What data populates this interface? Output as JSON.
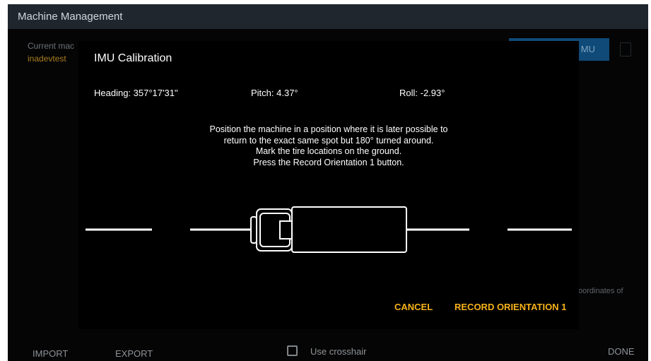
{
  "app": {
    "title": "Machine Management",
    "current_machine_label": "Current mac",
    "current_machine_value": "inadevtest",
    "imu_button_label": "MU",
    "coords_text": "oordinates of",
    "import_label": "IMPORT",
    "export_label": "EXPORT",
    "crosshair_label": "Use crosshair",
    "done_label": "DONE"
  },
  "dialog": {
    "title": "IMU Calibration",
    "heading": "Heading: 357°17'31\"",
    "pitch": "Pitch: 4.37°",
    "roll": "Roll: -2.93°",
    "instructions": [
      "Position the machine in a position where it is later possible to",
      "return to the exact same spot but 180° turned around.",
      "Mark the tire locations on the ground.",
      "Press the Record Orientation 1 button."
    ],
    "cancel_label": "CANCEL",
    "record_label": "RECORD ORIENTATION 1"
  },
  "colors": {
    "accent": "#f6b21a",
    "appbar": "#1f262d",
    "dialog_bg": "#000000",
    "primary_button": "#0f4a78"
  },
  "icons": {
    "machine": "truck-top-view-icon"
  }
}
